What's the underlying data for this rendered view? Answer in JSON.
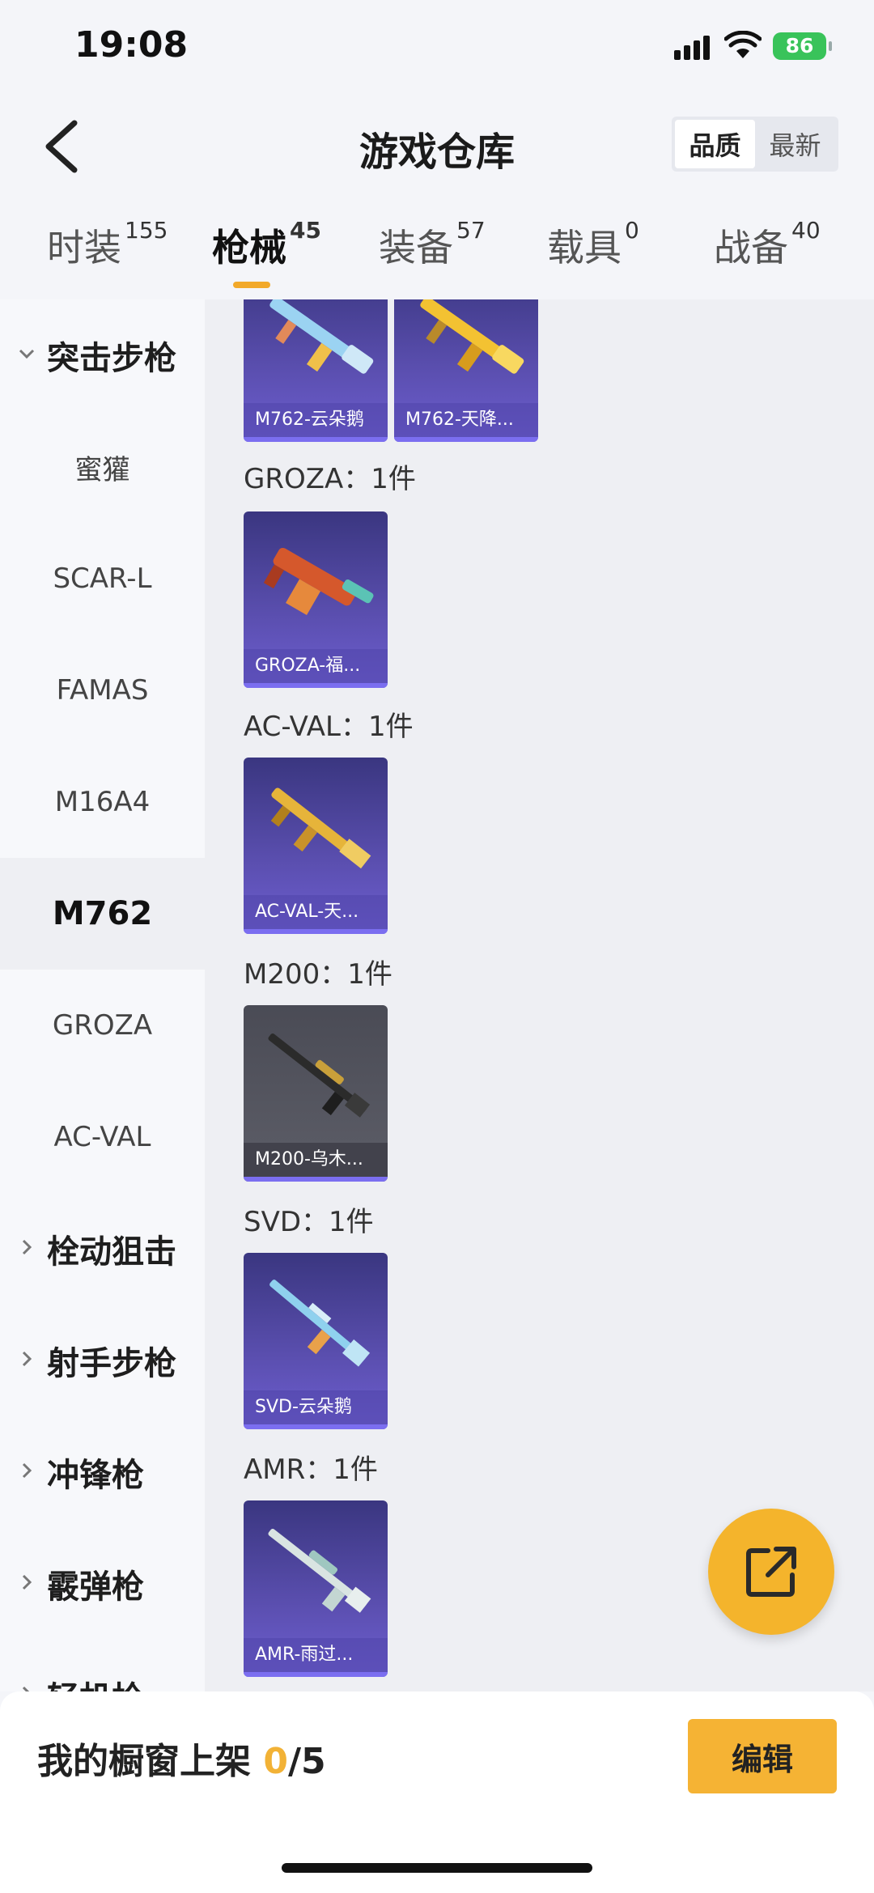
{
  "status": {
    "time": "19:08",
    "battery": "86"
  },
  "header": {
    "title": "游戏仓库",
    "sort_options": [
      "品质",
      "最新"
    ],
    "sort_active": "品质"
  },
  "tabs": [
    {
      "label": "时装",
      "count": "155"
    },
    {
      "label": "枪械",
      "count": "45"
    },
    {
      "label": "装备",
      "count": "57"
    },
    {
      "label": "载具",
      "count": "0"
    },
    {
      "label": "战备",
      "count": "40"
    }
  ],
  "sidebar": [
    {
      "label": "突击步枪"
    },
    {
      "label": "蜜獾"
    },
    {
      "label": "SCAR-L"
    },
    {
      "label": "FAMAS"
    },
    {
      "label": "M16A4"
    },
    {
      "label": "M762"
    },
    {
      "label": "GROZA"
    },
    {
      "label": "AC-VAL"
    },
    {
      "label": "栓动狙击"
    },
    {
      "label": "射手步枪"
    },
    {
      "label": "冲锋枪"
    },
    {
      "label": "霰弹枪"
    },
    {
      "label": "轻机枪"
    }
  ],
  "content": {
    "top_cards": [
      "M762-云朵鹅",
      "M762-天降..."
    ],
    "groups": [
      {
        "label": "GROZA：1件",
        "card": "GROZA-福..."
      },
      {
        "label": "AC-VAL：1件",
        "card": "AC-VAL-天..."
      },
      {
        "label": "M200：1件",
        "card": "M200-乌木..."
      },
      {
        "label": "SVD：1件",
        "card": "SVD-云朵鹅"
      },
      {
        "label": "AMR：1件",
        "card": "AMR-雨过..."
      }
    ]
  },
  "footer": {
    "showcase_label": "我的橱窗上架 ",
    "showcase_count": "0",
    "showcase_total": "/5",
    "edit_label": "编辑"
  },
  "colors": {
    "accent": "#f5b334",
    "card_purple": "#5b4fb0"
  },
  "icons": {
    "back": "chevron-left-icon",
    "share": "external-link-icon"
  }
}
